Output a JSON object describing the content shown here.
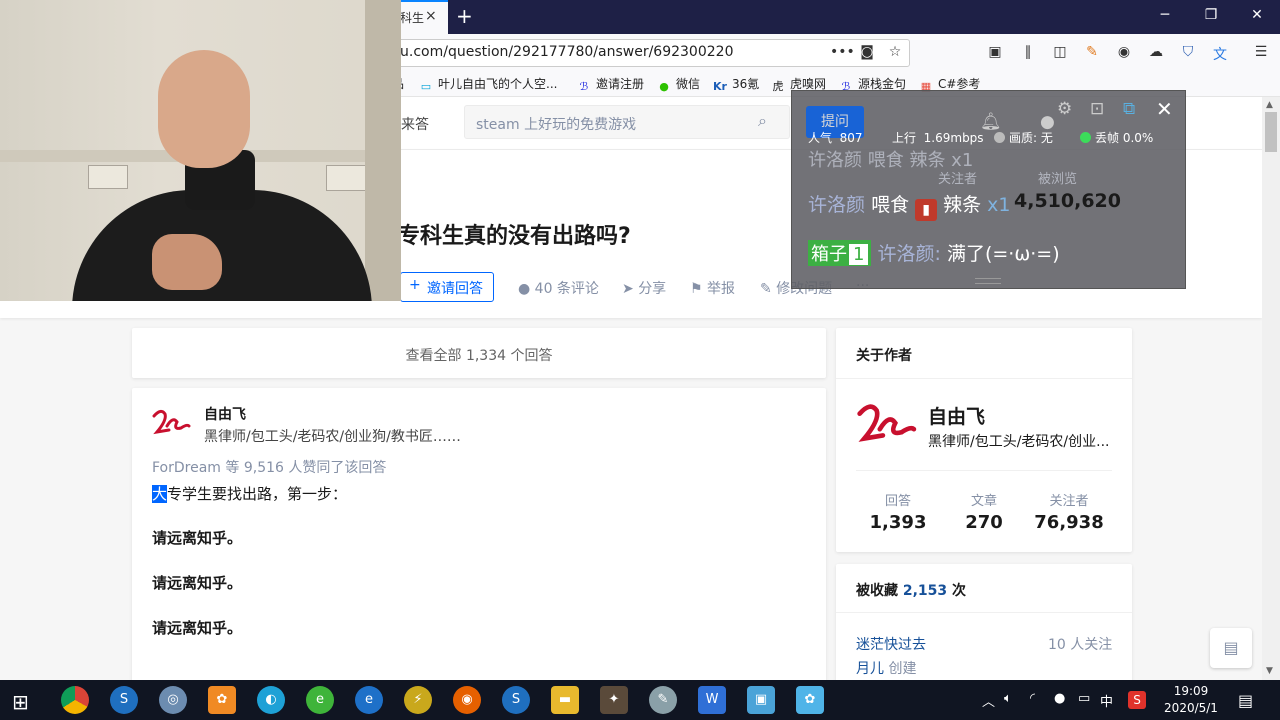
{
  "browser": {
    "tab_title": "科生",
    "tab_close": "×",
    "new_tab": "+",
    "url": "u.com/question/292177780/answer/692300220",
    "window_controls": {
      "minimize": "─",
      "restore": "❐",
      "close": "✕"
    },
    "toolbar_icons": [
      "ellipsis-icon",
      "pocket-icon",
      "star-icon",
      "reader-icon",
      "library-icon",
      "sidebar-icon",
      "extension-icon",
      "account-icon",
      "sync-icon",
      "shield-icon",
      "translate-icon",
      "menu-icon"
    ]
  },
  "bookmarks": [
    {
      "label": "叶儿自由飞的个人空...",
      "icon": "bilibili-icon"
    },
    {
      "label": "邀请注册",
      "icon": "baidu-icon"
    },
    {
      "label": "微信",
      "icon": "wechat-icon"
    },
    {
      "label": "36氪",
      "icon": "kr-icon"
    },
    {
      "label": "虎嗅网",
      "icon": "huxiu-icon"
    },
    {
      "label": "源栈金句",
      "icon": "baidu-icon"
    },
    {
      "label": "C#参考",
      "icon": "windows-icon"
    }
  ],
  "header": {
    "nav_answer": "来答",
    "search_placeholder": "steam 上好玩的免费游戏",
    "ask_button": "提问"
  },
  "question": {
    "title": "专科生真的没有出路吗?",
    "invite_label": "邀请回答",
    "comments": "40 条评论",
    "share": "分享",
    "report": "举报",
    "edit": "修改问题",
    "more": "···"
  },
  "answers": {
    "view_all": "查看全部 1,334 个回答",
    "author_name": "自由飞",
    "author_bio": "黑律师/包工头/老码农/创业狗/教书匠……",
    "votes_text": "ForDream 等 9,516 人赞同了该回答",
    "first_char": "大",
    "first_rest": "专学生要找出路，第一步：",
    "lines": [
      "请远离知乎。",
      "请远离知乎。",
      "请远离知乎。"
    ]
  },
  "about": {
    "heading": "关于作者",
    "name": "自由飞",
    "bio": "黑律师/包工头/老码农/创业...",
    "stats": [
      {
        "label": "回答",
        "value": "1,393"
      },
      {
        "label": "文章",
        "value": "270"
      },
      {
        "label": "关注者",
        "value": "76,938"
      }
    ]
  },
  "favorites": {
    "prefix": "被收藏",
    "count": "2,153",
    "suffix": "次",
    "collection_name": "迷茫快过去",
    "collection_followers": "10 人关注",
    "creator": "月儿",
    "creator_suffix": "创建"
  },
  "overlay": {
    "ask": "提问",
    "popularity_label": "人气",
    "popularity": "807",
    "upload_label": "上行",
    "upload": "1.69mbps",
    "quality_label": "画质:",
    "quality": "无",
    "drop_label": "丢帧",
    "drop": "0.0%",
    "faded_row": "许洛颜 喂食 辣条 x1",
    "faded_followers": "关注者",
    "faded_views": "被浏览",
    "views_value": "4,510,620",
    "msg2_user": "许洛颜",
    "msg2_action": "喂食",
    "msg2_gift": "辣条",
    "msg2_count": "x1",
    "box_label": "箱子",
    "box_level": "1",
    "msg3_user": "许洛颜:",
    "msg3_text": "满了(=·ω·=)",
    "colors": {
      "quality_dot": "#bbbbbb",
      "drop_dot": "#3cdc5a"
    }
  },
  "taskbar": {
    "apps": [
      "chrome-icon",
      "app-s-icon",
      "browser-icon",
      "weibo-icon",
      "edge-legacy-icon",
      "green-browser-icon",
      "edge-icon",
      "app-yellow-icon",
      "firefox-icon",
      "app-s2-icon",
      "explorer-icon",
      "app-game-icon",
      "app-pen-icon",
      "wps-icon",
      "app-photo-icon",
      "app-bili-icon"
    ],
    "tray_ime": "中",
    "time": "19:09",
    "date": "2020/5/1"
  }
}
